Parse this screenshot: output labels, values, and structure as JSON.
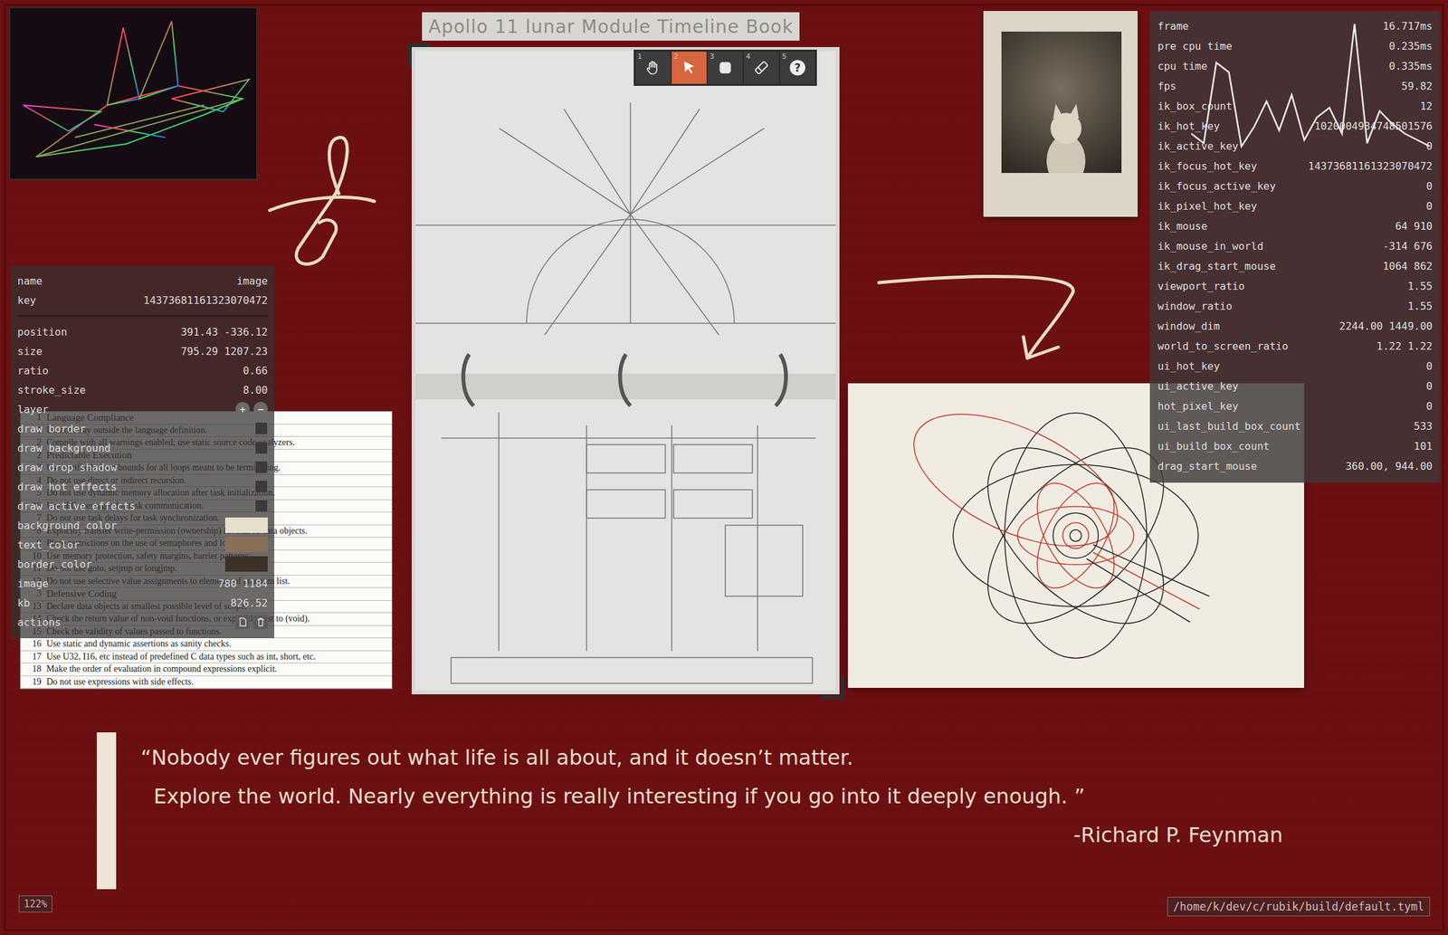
{
  "canvas_title": "Apollo 11 lunar Module Timeline Book",
  "toolbar": [
    {
      "number": "1",
      "kind": "hand",
      "selected": false,
      "glyph": ""
    },
    {
      "number": "2",
      "kind": "pointer",
      "selected": true,
      "glyph": ""
    },
    {
      "number": "3",
      "kind": "shape",
      "selected": false,
      "glyph": ""
    },
    {
      "number": "4",
      "kind": "eraser",
      "selected": false,
      "glyph": ""
    },
    {
      "number": "5",
      "kind": "help",
      "selected": false,
      "glyph": "?"
    }
  ],
  "properties": {
    "header": [
      {
        "label": "name",
        "value": "image"
      },
      {
        "label": "key",
        "value": "14373681161323070472"
      }
    ],
    "rows": [
      {
        "kind": "value",
        "label": "position",
        "value": "391.43 -336.12"
      },
      {
        "kind": "value",
        "label": "size",
        "value": "795.29 1207.23"
      },
      {
        "kind": "value",
        "label": "ratio",
        "value": "0.66"
      },
      {
        "kind": "value",
        "label": "stroke_size",
        "value": "8.00"
      },
      {
        "kind": "layer",
        "label": "layer",
        "buttons": [
          "+",
          "−"
        ]
      },
      {
        "kind": "checkbox",
        "label": "draw border",
        "checked": false
      },
      {
        "kind": "checkbox",
        "label": "draw background",
        "checked": false
      },
      {
        "kind": "checkbox",
        "label": "draw drop shadow",
        "checked": false
      },
      {
        "kind": "checkbox",
        "label": "draw hot effects",
        "checked": false
      },
      {
        "kind": "checkbox",
        "label": "draw active effects",
        "checked": false
      },
      {
        "kind": "color",
        "label": "background_color",
        "color": "#e6dfcc"
      },
      {
        "kind": "color",
        "label": "text_color",
        "color": "#8a7056"
      },
      {
        "kind": "color",
        "label": "border_color",
        "color": "#3d3027"
      },
      {
        "kind": "value",
        "label": "image",
        "value": "780 1184"
      },
      {
        "kind": "value",
        "label": "kb",
        "value": "826.52"
      },
      {
        "kind": "actions",
        "label": "actions"
      }
    ]
  },
  "rules_document": [
    {
      "kind": "heading",
      "number": "1",
      "text": "Language Compliance"
    },
    {
      "kind": "rule",
      "number": "1",
      "text": "Do not stray outside the language definition."
    },
    {
      "kind": "rule",
      "number": "2",
      "text": "Compile with all warnings enabled; use static source code analyzers."
    },
    {
      "kind": "heading",
      "number": "2",
      "text": "Predictable Execution"
    },
    {
      "kind": "rule",
      "number": "3",
      "text": "Use verifiable loop bounds for all loops meant to be terminating."
    },
    {
      "kind": "rule",
      "number": "4",
      "text": "Do not use direct or indirect recursion."
    },
    {
      "kind": "rule",
      "number": "5",
      "text": "Do not use dynamic memory allocation after task initialization."
    },
    {
      "kind": "rule",
      "number": "*6",
      "text": "Use IPC messages for task communication."
    },
    {
      "kind": "rule",
      "number": "7",
      "text": "Do not use task delays for task synchronization."
    },
    {
      "kind": "rule",
      "number": "*8",
      "text": "Explicitly transfer write-permission (ownership) for shared data objects."
    },
    {
      "kind": "rule",
      "number": "9",
      "text": "Place restrictions on the use of semaphores and locks."
    },
    {
      "kind": "rule",
      "number": "10",
      "text": "Use memory protection, safety margins, barrier patterns."
    },
    {
      "kind": "rule",
      "number": "11",
      "text": "Do not use goto, setjmp or longjmp."
    },
    {
      "kind": "rule",
      "number": "12",
      "text": "Do not use selective value assignments to elements of an enum list."
    },
    {
      "kind": "heading",
      "number": "3",
      "text": "Defensive Coding"
    },
    {
      "kind": "rule",
      "number": "13",
      "text": "Declare data objects at smallest possible level of scope."
    },
    {
      "kind": "rule",
      "number": "14",
      "text": "Check the return value of non-void functions, or explicitly cast to (void)."
    },
    {
      "kind": "rule",
      "number": "15",
      "text": "Check the validity of values passed to functions."
    },
    {
      "kind": "rule",
      "number": "16",
      "text": "Use static and dynamic assertions as sanity checks."
    },
    {
      "kind": "rule",
      "number": "17",
      "text": "Use U32, I16, etc instead of predefined C data types such as int, short, etc."
    },
    {
      "kind": "rule",
      "number": "18",
      "text": "Make the order of evaluation in compound expressions explicit."
    },
    {
      "kind": "rule",
      "number": "19",
      "text": "Do not use expressions with side effects."
    }
  ],
  "debug": {
    "rows": [
      {
        "label": "frame",
        "value": "16.717ms"
      },
      {
        "label": "pre cpu time",
        "value": "0.235ms"
      },
      {
        "label": "cpu time",
        "value": "0.335ms"
      },
      {
        "label": "fps",
        "value": "59.82"
      },
      {
        "label": "ik_box_count",
        "value": "12"
      },
      {
        "label": "ik_hot_key",
        "value": "1020004934748501576"
      },
      {
        "label": "ik_active_key",
        "value": "0"
      },
      {
        "label": "ik_focus_hot_key",
        "value": "14373681161323070472"
      },
      {
        "label": "ik_focus_active_key",
        "value": "0"
      },
      {
        "label": "ik_pixel_hot_key",
        "value": "0"
      },
      {
        "label": "ik_mouse",
        "value": "64 910"
      },
      {
        "label": "ik_mouse_in_world",
        "value": "-314 676"
      },
      {
        "label": "ik_drag_start_mouse",
        "value": "1064 862"
      },
      {
        "label": "viewport_ratio",
        "value": "1.55"
      },
      {
        "label": "window_ratio",
        "value": "1.55"
      },
      {
        "label": "window_dim",
        "value": "2244.00 1449.00"
      },
      {
        "label": "world_to_screen_ratio",
        "value": "1.22 1.22"
      },
      {
        "label": "ui_hot_key",
        "value": "0"
      },
      {
        "label": "ui_active_key",
        "value": "0"
      },
      {
        "label": "hot_pixel_key",
        "value": "0"
      },
      {
        "label": "ui_last_build_box_count",
        "value": "533"
      },
      {
        "label": "ui_build_box_count",
        "value": "101"
      },
      {
        "label": "drag_start_mouse",
        "value": "360.00, 944.00"
      }
    ],
    "frame_graph": [
      12,
      9,
      34,
      31,
      8,
      14,
      22,
      13,
      24,
      10,
      17,
      20,
      12,
      46,
      9,
      19,
      15,
      12,
      10,
      8
    ]
  },
  "quote": {
    "lines": [
      "“Nobody ever figures out what life is all about, and it doesn’t matter.",
      "Explore the world. Nearly everything is really interesting if you go into it deeply enough. ”"
    ],
    "author": "-Richard P. Feynman"
  },
  "zoom": "122%",
  "file_path": "/home/k/dev/c/rubik/build/default.tyml"
}
